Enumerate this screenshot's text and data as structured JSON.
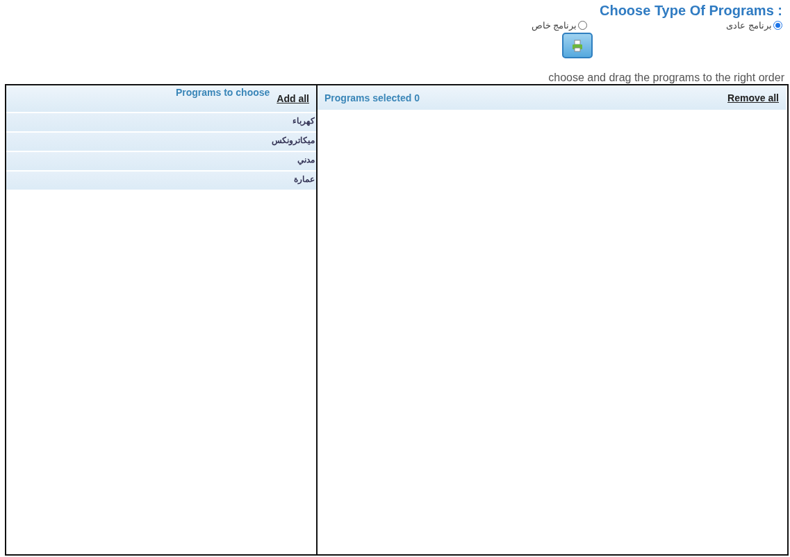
{
  "title": "Choose Type Of Programs :",
  "program_types": [
    {
      "label": "برنامج عادى",
      "selected": true
    },
    {
      "label": "برنامج خاص",
      "selected": false
    }
  ],
  "instruction": "choose and drag the programs to the right order",
  "available": {
    "heading": "Programs to choose",
    "action": "Add all",
    "items": [
      "كهرباء",
      "ميكاترونكس",
      "مدني",
      "عمارة"
    ]
  },
  "selected_panel": {
    "heading": "Programs selected 0",
    "action": "Remove all"
  }
}
